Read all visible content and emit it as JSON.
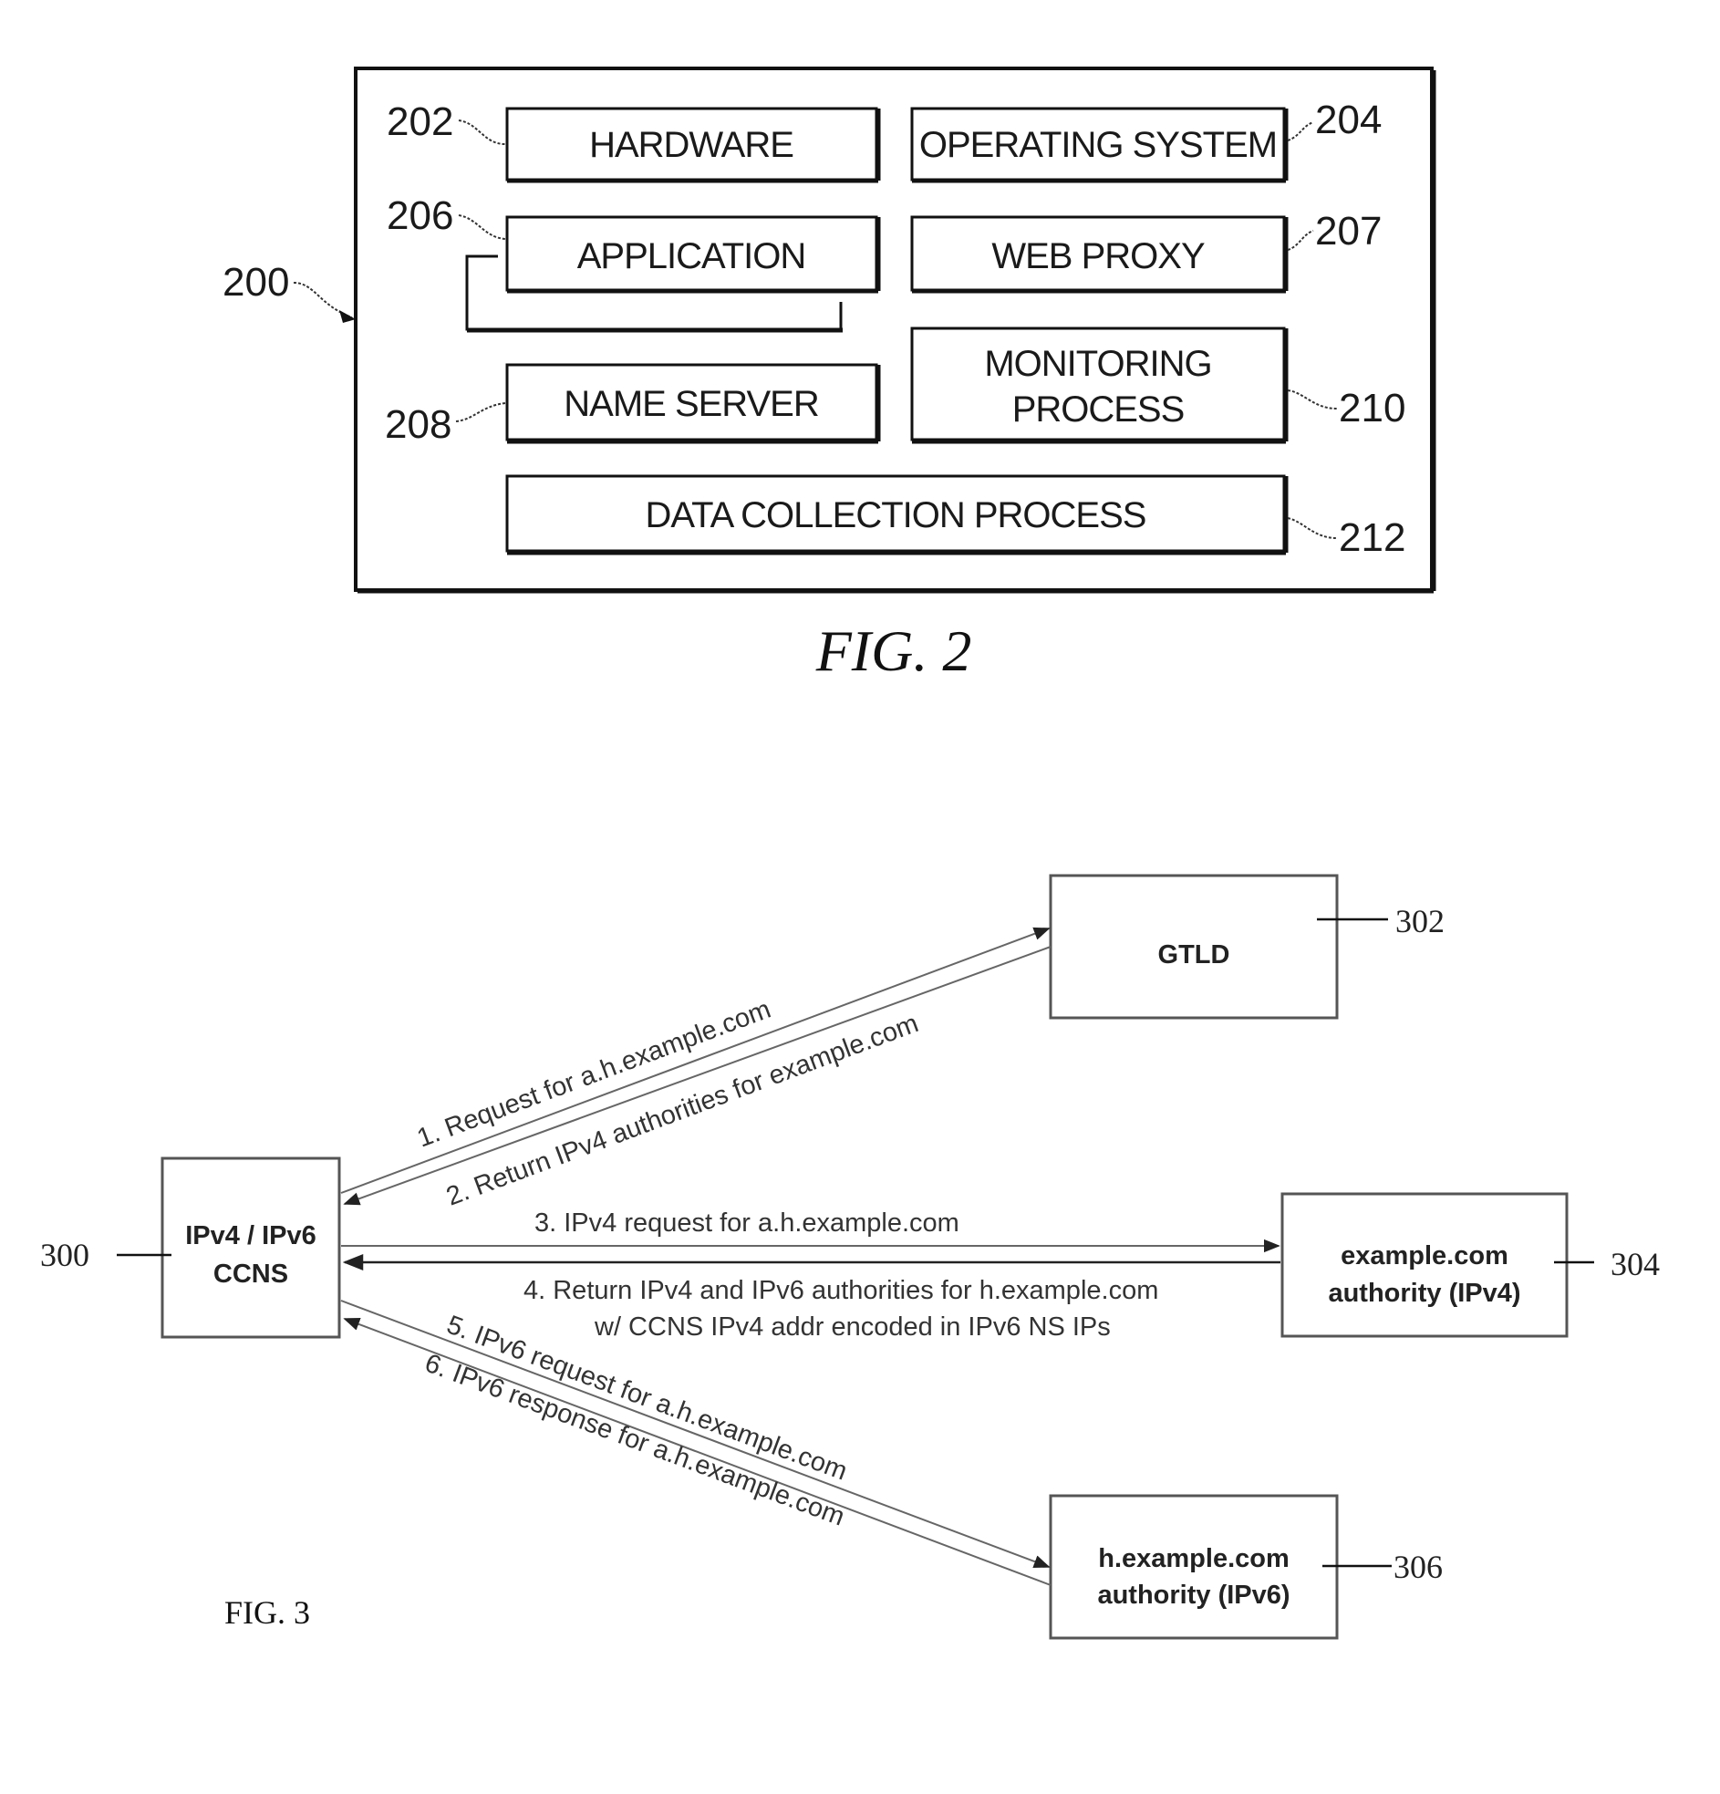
{
  "fig2": {
    "caption": "FIG. 2",
    "system_ref": "200",
    "components": [
      {
        "id": "hardware",
        "label": "HARDWARE",
        "ref": "202"
      },
      {
        "id": "operating-system",
        "label": "OPERATING SYSTEM",
        "ref": "204"
      },
      {
        "id": "application",
        "label": "APPLICATION",
        "ref": "206"
      },
      {
        "id": "web-proxy",
        "label": "WEB PROXY",
        "ref": "207"
      },
      {
        "id": "name-server",
        "label": "NAME SERVER",
        "ref": "208"
      },
      {
        "id": "monitoring-process",
        "label_line1": "MONITORING",
        "label_line2": "PROCESS",
        "ref": "210"
      },
      {
        "id": "data-collection-process",
        "label": "DATA COLLECTION PROCESS",
        "ref": "212"
      }
    ]
  },
  "fig3": {
    "caption": "FIG. 3",
    "nodes": [
      {
        "id": "ccns",
        "line1": "IPv4 / IPv6",
        "line2": "CCNS",
        "ref": "300"
      },
      {
        "id": "gtld",
        "line1": "GTLD",
        "ref": "302"
      },
      {
        "id": "example-authority",
        "line1": "example.com",
        "line2": "authority (IPv4)",
        "ref": "304"
      },
      {
        "id": "h-example-authority",
        "line1": "h.example.com",
        "line2": "authority (IPv6)",
        "ref": "306"
      }
    ],
    "messages": [
      {
        "step": 1,
        "text": "1. Request for a.h.example.com"
      },
      {
        "step": 2,
        "text": "2. Return IPv4 authorities for example.com"
      },
      {
        "step": 3,
        "text": "3. IPv4 request for a.h.example.com"
      },
      {
        "step": 4,
        "line1": "4. Return IPv4 and IPv6 authorities for h.example.com",
        "line2": "w/ CCNS IPv4 addr encoded in IPv6 NS IPs"
      },
      {
        "step": 5,
        "text": "5. IPv6 request for a.h.example.com"
      },
      {
        "step": 6,
        "text": "6. IPv6 response for a.h.example.com"
      }
    ]
  }
}
